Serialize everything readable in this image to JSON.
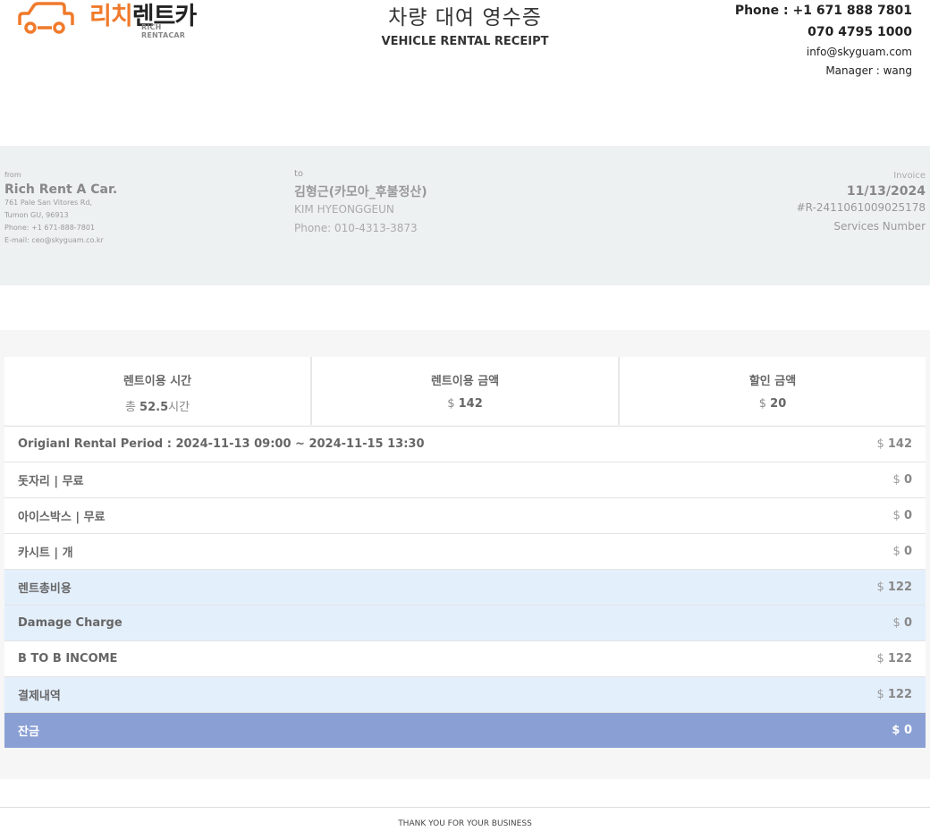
{
  "header": {
    "logo_ko_a": "리치",
    "logo_ko_b": "렌트카",
    "logo_en": "RICH RENTACAR",
    "title_ko": "차량 대여 영수증",
    "title_en": "VEHICLE RENTAL RECEIPT",
    "phone": "Phone : +1 671 888 7801",
    "phone2": "070 4795 1000",
    "email": "info@skyguam.com",
    "manager": "Manager : wang"
  },
  "from": {
    "label": "from",
    "name": "Rich Rent A Car.",
    "address1": "761 Pale San Vitores Rd,",
    "address2": "Tumon GU, 96913",
    "phone": "Phone: +1 671-888-7801",
    "email": "E-mail: ceo@skyguam.co.kr"
  },
  "to": {
    "label": "to",
    "name": "김형근(카모아_후불정산)",
    "name_en": "KIM HYEONGGEUN",
    "phone": "Phone: 010-4313-3873"
  },
  "invoice": {
    "label": "Invoice",
    "date": "11/13/2024",
    "number": "#R-2411061009025178",
    "services": "Services Number"
  },
  "summary": [
    {
      "header": "렌트이용 시간",
      "prefix": "총 ",
      "value": "52.5",
      "suffix": "시간"
    },
    {
      "header": "렌트이용 금액",
      "prefix": "$ ",
      "value": "142",
      "suffix": ""
    },
    {
      "header": "할인 금액",
      "prefix": "$ ",
      "value": "20",
      "suffix": ""
    }
  ],
  "rows": [
    {
      "label": "Origianl Rental Period : 2024-11-13 09:00 ~ 2024-11-15 13:30",
      "amount": "142"
    },
    {
      "label": "돗자리 | 무료",
      "amount": "0"
    },
    {
      "label": "아이스박스 | 무료",
      "amount": "0"
    },
    {
      "label": "카시트 | 개",
      "amount": "0"
    },
    {
      "label": "렌트총비용",
      "amount": "122"
    },
    {
      "label": "Damage Charge",
      "amount": "0"
    },
    {
      "label": "B TO B INCOME",
      "amount": "122"
    },
    {
      "label": "결제내역",
      "amount": "122"
    },
    {
      "label": "잔금",
      "amount": "0"
    }
  ],
  "currency": "$ ",
  "footer": "THANK YOU FOR YOUR BUSINESS",
  "colors": {
    "brand_orange": "#f07a2b",
    "row_blue": "#e4effc",
    "final_row": "#8a9fd4"
  }
}
